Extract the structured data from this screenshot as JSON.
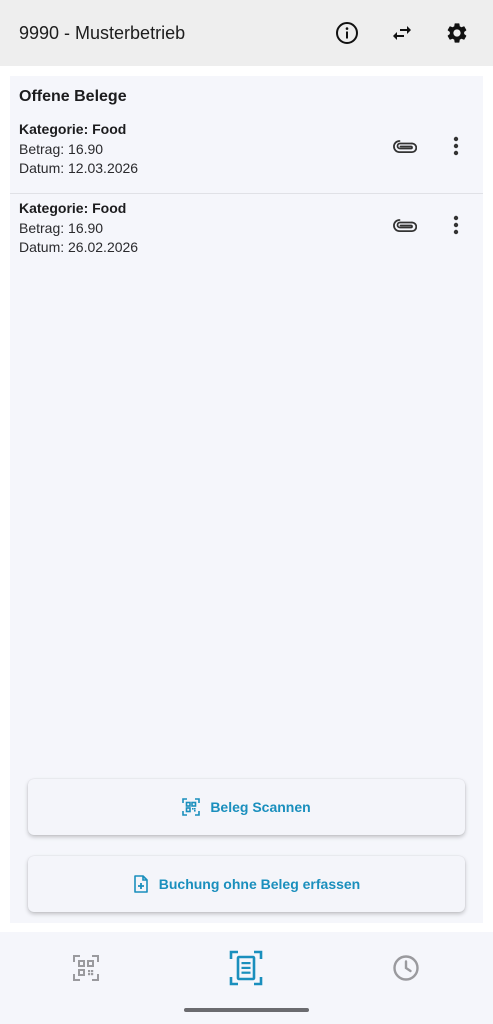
{
  "app_bar": {
    "title": "9990 - Musterbetrieb",
    "actions": [
      "info-icon",
      "swap-icon",
      "settings-icon"
    ]
  },
  "section": {
    "title": "Offene Belege"
  },
  "entries": [
    {
      "category": "Kategorie: Food",
      "amount": "Betrag: 16.90",
      "date": "Datum: 12.03.2026"
    },
    {
      "category": "Kategorie: Food",
      "amount": "Betrag: 16.90",
      "date": "Datum: 26.02.2026"
    }
  ],
  "buttons": {
    "scan_label": "Beleg Scannen",
    "book_label": "Buchung ohne Beleg erfassen"
  },
  "bottom_nav": {
    "items": [
      "qr-scan-icon",
      "receipt-list-icon",
      "history-icon"
    ],
    "active_index": 1
  },
  "colors": {
    "accent": "#1a8fbd",
    "inactive_icon": "#9a9a9e",
    "app_bar_bg": "#eeeeee",
    "content_bg": "#f5f6fb"
  }
}
